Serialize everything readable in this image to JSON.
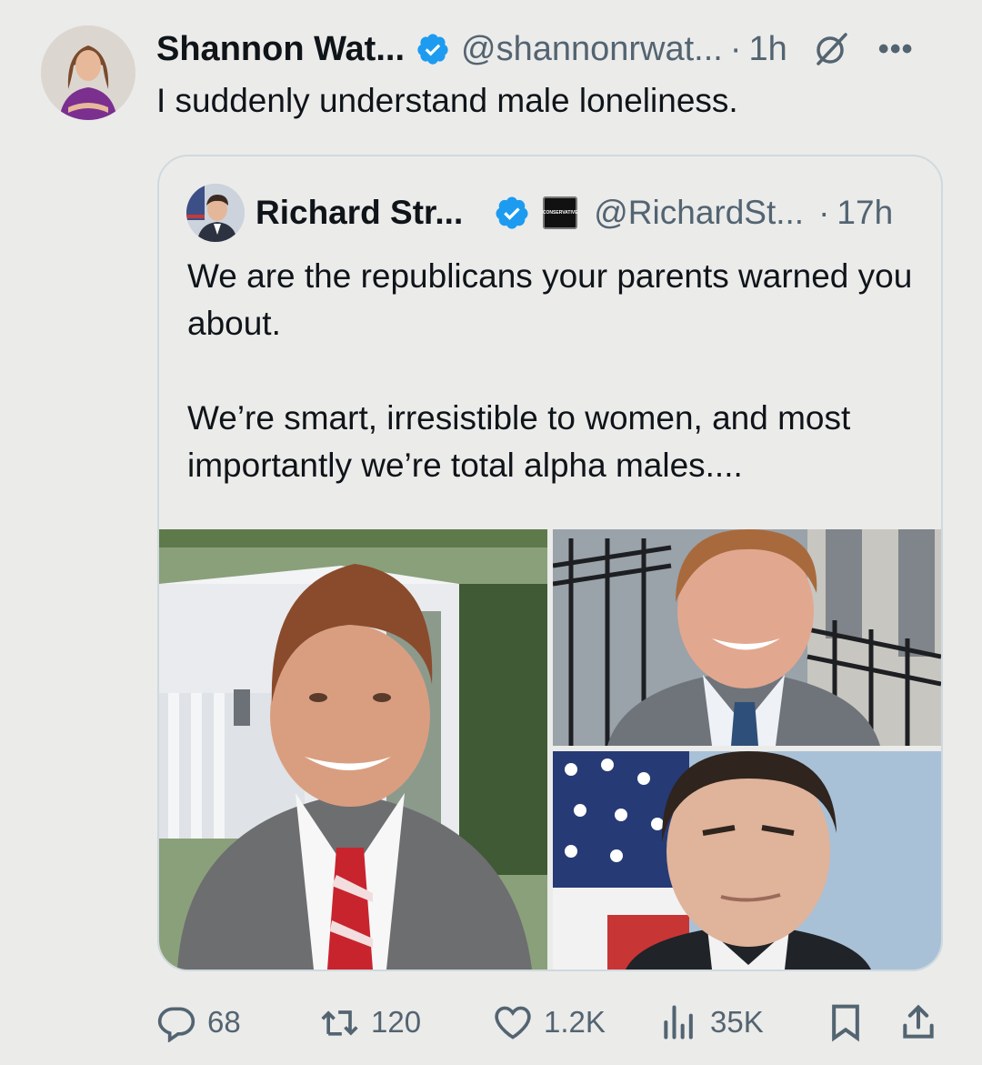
{
  "post": {
    "author_name": "Shannon Wat...",
    "author_handle": "@shannonrwat...",
    "separator": "·",
    "time": "1h",
    "more_label": "•••",
    "text": "I suddenly understand male loneliness."
  },
  "quote": {
    "author_name": "Richard Str...",
    "badge_text": "CONSERVATIVE",
    "author_handle": "@RichardSt...",
    "separator": "·",
    "time": "17h",
    "paragraphs": [
      "We are the republicans your parents warned you about.",
      "We’re smart, irresistible to women, and most importantly we’re total alpha males...."
    ]
  },
  "actions": {
    "replies": "68",
    "reposts": "120",
    "likes": "1.2K",
    "views": "35K"
  },
  "colors": {
    "background": "#ebebea",
    "text": "#0f1419",
    "secondary_text": "#536471",
    "verified_blue": "#1d9bf0",
    "border": "#cfd9de"
  },
  "icons": [
    "verified-badge-icon",
    "grok-icon",
    "more-icon",
    "reply-icon",
    "repost-icon",
    "like-icon",
    "views-icon",
    "bookmark-icon",
    "share-icon"
  ]
}
